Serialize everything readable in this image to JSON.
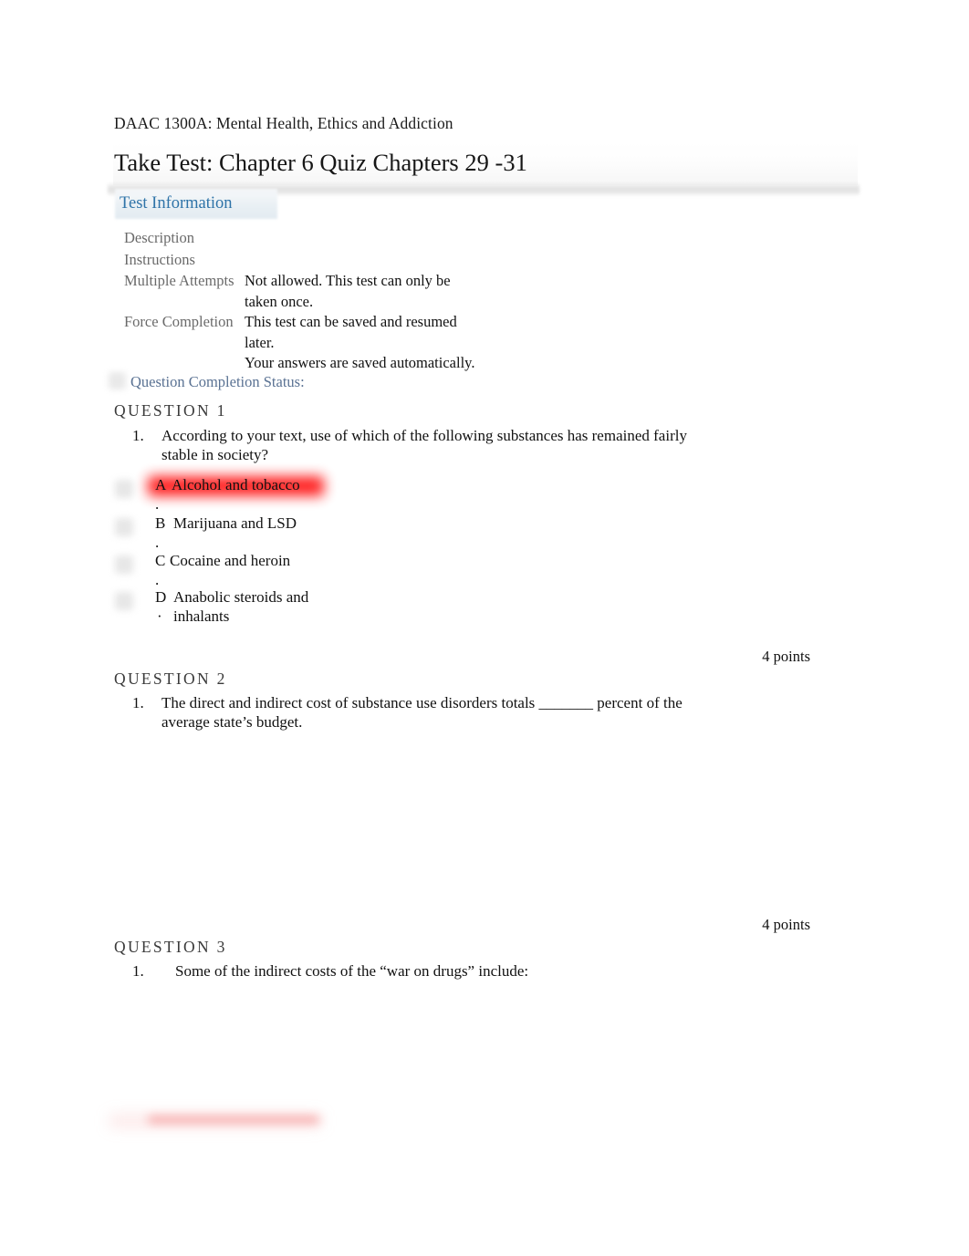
{
  "document": {
    "course_line": "DAAC 1300A: Mental Health, Ethics and Addiction",
    "page_title": "Take Test: Chapter 6 Quiz Chapters 29 -31"
  },
  "test_information": {
    "tab_label": "Test Information",
    "rows": [
      {
        "key": "Description",
        "value": ""
      },
      {
        "key": "Instructions",
        "value": ""
      },
      {
        "key": "Multiple Attempts",
        "value": "Not allowed. This test can only be taken once."
      },
      {
        "key": "Force Completion",
        "value": "This test can be saved and resumed later."
      },
      {
        "key": "",
        "value": "Your answers are saved automatically."
      }
    ]
  },
  "status": {
    "completion_label": "Question Completion Status:"
  },
  "questions": [
    {
      "heading": "QUESTION 1",
      "number": "1.",
      "text": "According to your text, use of which of the following substances has remained fairly stable in society?",
      "points": "4 points",
      "options": [
        {
          "letter": "A",
          "dot": ".",
          "text": "Alcohol and tobacco",
          "highlighted": true
        },
        {
          "letter": "B",
          "dot": ".",
          "text": "Marijuana and LSD",
          "highlighted": false
        },
        {
          "letter": "C",
          "dot": ".",
          "text": "Cocaine and heroin",
          "highlighted": false
        },
        {
          "letter": "D",
          "dot": "·",
          "text": "Anabolic steroids and inhalants",
          "highlighted": false
        }
      ]
    },
    {
      "heading": "QUESTION 2",
      "number": "1.",
      "text": "The direct and indirect cost of substance use disorders totals _______ percent of the average state’s budget.",
      "points": "4 points",
      "options": []
    },
    {
      "heading": "QUESTION 3",
      "number": "1.",
      "text": "Some of the indirect costs of the “war on drugs” include:",
      "points": "",
      "options": []
    }
  ],
  "colors": {
    "link_blue": "#2e73a8",
    "status_blue": "#5a7293",
    "highlight_red": "#ff1212",
    "label_gray": "#6a6a6a"
  }
}
